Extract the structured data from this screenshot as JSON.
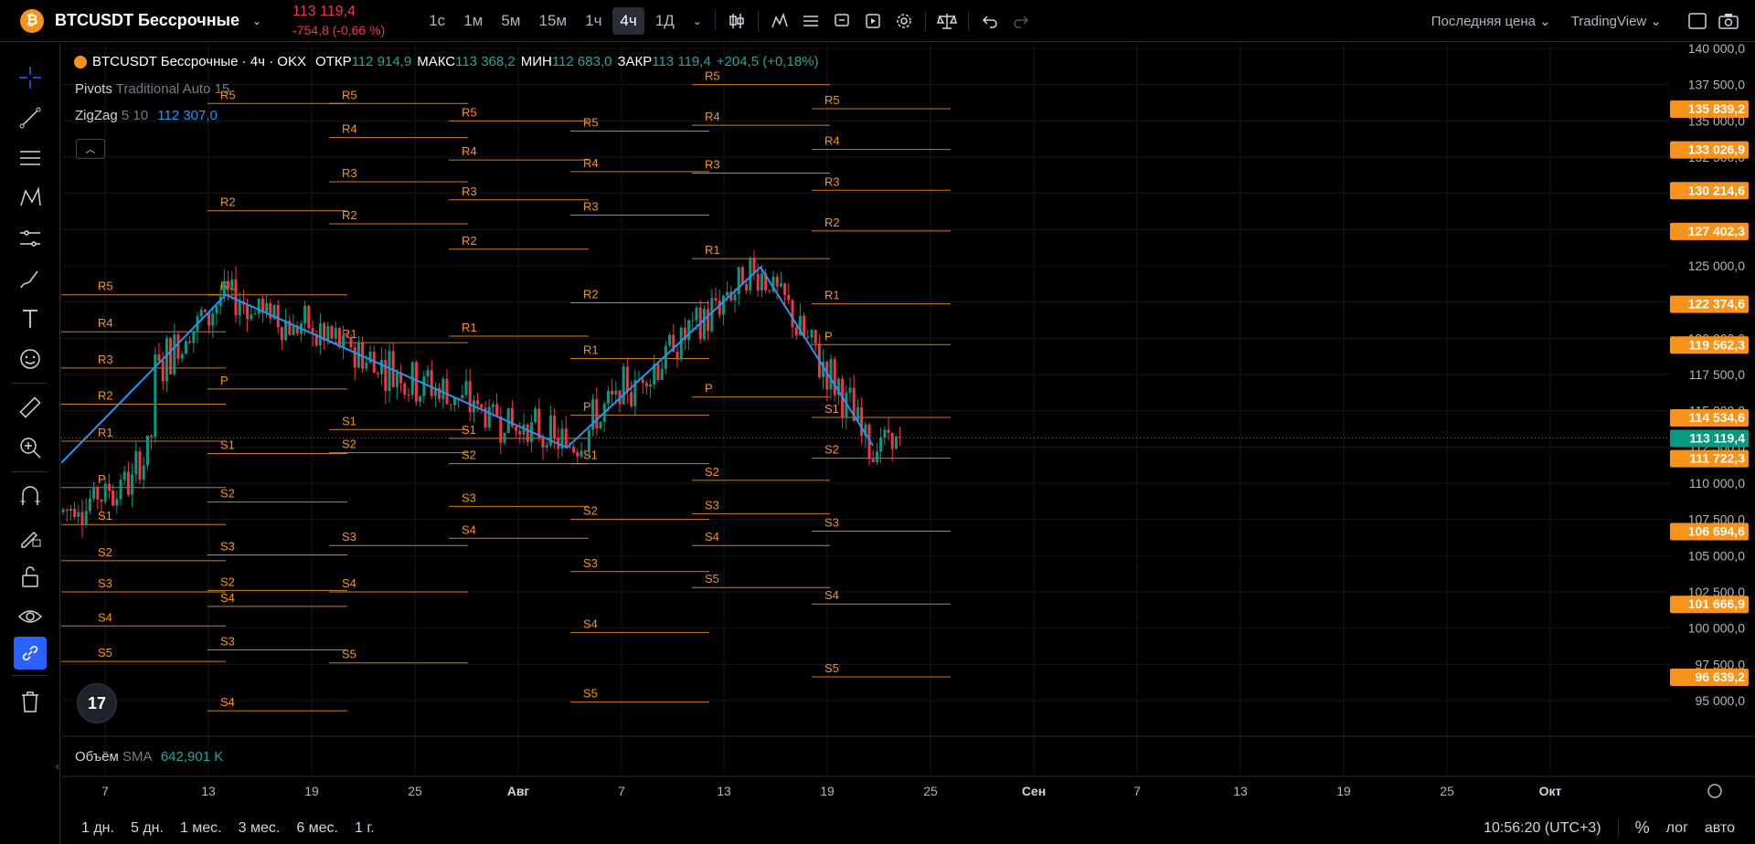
{
  "header": {
    "symbol": "BTCUSDT Бессрочные",
    "last_price": "113 119,4",
    "change": "-754,8 (-0,66 %)",
    "timeframes": [
      "1с",
      "1м",
      "5м",
      "15м",
      "1ч",
      "4ч",
      "1Д"
    ],
    "active_timeframe": "4ч",
    "price_type": "Последняя цена",
    "broker": "TradingView"
  },
  "legend": {
    "title": "BTCUSDT Бессрочные · 4ч · OKX",
    "open_label": "ОТКР",
    "open": "112 914,9",
    "high_label": "МАКС",
    "high": "113 368,2",
    "low_label": "МИН",
    "low": "112 683,0",
    "close_label": "ЗАКР",
    "close": "113 119,4",
    "change": "+204,5 (+0,18%)"
  },
  "indicators": {
    "pivots_name": "Pivots",
    "pivots_params": "Traditional Auto 15",
    "zigzag_name": "ZigZag",
    "zigzag_params": "5 10",
    "zigzag_value": "112 307,0"
  },
  "volume": {
    "name": "Объём",
    "ma": "SMA",
    "value": "642,901 K"
  },
  "price_axis": {
    "ticks": [
      "140 000,0",
      "137 500,0",
      "135 000,0",
      "132 500,0",
      "130 000,0",
      "127 500,0",
      "125 000,0",
      "122 500,0",
      "120 000,0",
      "117 500,0",
      "115 000,0",
      "112 500,0",
      "110 000,0",
      "107 500,0",
      "105 000,0",
      "102 500,0",
      "100 000,0",
      "97 500,0",
      "95 000,0"
    ],
    "labels": [
      "135 839,2",
      "133 026,9",
      "130 214,6",
      "127 402,3",
      "122 374,6",
      "119 562,3",
      "114 534,6",
      "111 722,3",
      "106 694,6",
      "101 666,9",
      "96 639,2"
    ],
    "last_label": "113 119,4",
    "colors": {
      "pivot": "#f7931a",
      "last": "#089981",
      "zigzag": "#2196f3",
      "up": "#089981",
      "down": "#f23645"
    }
  },
  "time_axis": [
    "7",
    "13",
    "19",
    "25",
    "Авг",
    "7",
    "13",
    "19",
    "25",
    "Сен",
    "7",
    "13",
    "19",
    "25",
    "Окт"
  ],
  "pivot_labels": [
    "R5",
    "R4",
    "R3",
    "R2",
    "R1",
    "P",
    "S1",
    "S2",
    "S3",
    "S4",
    "S5"
  ],
  "ranges": [
    "1 дн.",
    "5 дн.",
    "1 мес.",
    "3 мес.",
    "6 мес.",
    "1 г."
  ],
  "footer": {
    "time": "10:56:20 (UTC+3)",
    "percent": "%",
    "log": "лог",
    "auto": "авто"
  },
  "logo_text": "17"
}
